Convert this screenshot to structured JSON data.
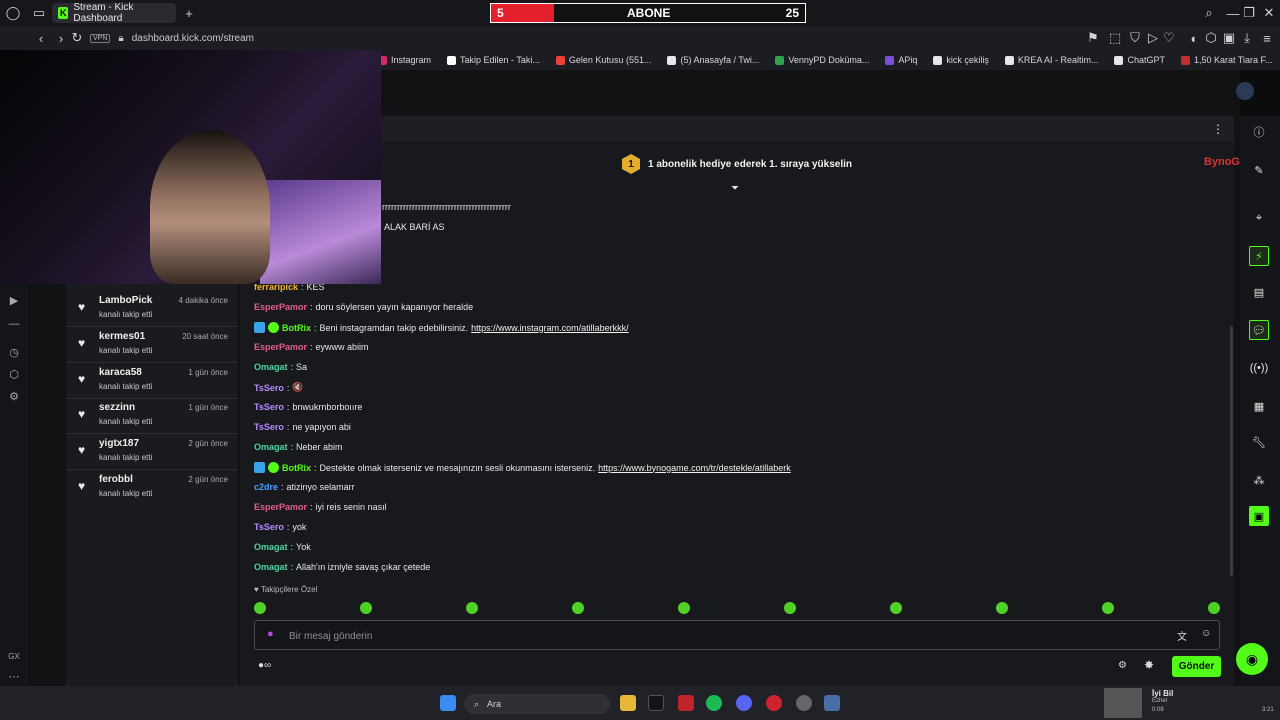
{
  "browser": {
    "tab_title": "Stream - Kick Dashboard",
    "url": "dashboard.kick.com/stream",
    "vpn_label": "VPN",
    "bookmarks": [
      {
        "label": "Instagram",
        "color": "#d6296b"
      },
      {
        "label": "Takip Edilen - Taki...",
        "color": "#ffffff"
      },
      {
        "label": "Gelen Kutusu (551...",
        "color": "#ea4335"
      },
      {
        "label": "(5) Anasayfa / Twi...",
        "color": "#e7e7e7"
      },
      {
        "label": "VennyPD Doküma...",
        "color": "#2ea44f"
      },
      {
        "label": "APiq",
        "color": "#7b4dd8"
      },
      {
        "label": "kick çekiliş",
        "color": "#e7e7e7"
      },
      {
        "label": "KREA AI - Realtim...",
        "color": "#e7e7e7"
      },
      {
        "label": "ChatGPT",
        "color": "#e7e7e7"
      },
      {
        "label": "1,50 Karat Tiara F...",
        "color": "#c03030"
      }
    ]
  },
  "overlay": {
    "left_count": "5",
    "label": "ABONE",
    "right_count": "25",
    "progress": 0.2
  },
  "follows": [
    {
      "name": "LamboPick",
      "action": "kanalı takip etti",
      "time": "4 dakika önce"
    },
    {
      "name": "kermes01",
      "action": "kanalı takip etti",
      "time": "20 saat önce"
    },
    {
      "name": "karaca58",
      "action": "kanalı takip etti",
      "time": "1 gün önce"
    },
    {
      "name": "sezzinn",
      "action": "kanalı takip etti",
      "time": "1 gün önce"
    },
    {
      "name": "yigtx187",
      "action": "kanalı takip etti",
      "time": "2 gün önce"
    },
    {
      "name": "ferobbl",
      "action": "kanalı takip etti",
      "time": "2 gün önce"
    }
  ],
  "chat": {
    "banner_badge": "1",
    "banner_text": "1 abonelik hediye ederek 1. sıraya yükselin",
    "sponsor_text": "BynoGame",
    "partial_lines": [
      "rrrrrrrrrrrrrrrrrrrrrrrrrrrrrrrrrrrrrrrrrrr",
      "ALAK BARİ AS"
    ],
    "messages": [
      {
        "user": "ferraripick",
        "color": "#f0b43a",
        "text": "KES",
        "bot": false
      },
      {
        "user": "EsperPamor",
        "color": "#e85b8f",
        "text": "doru söylersen yayın kapanıyor heralde",
        "bot": false
      },
      {
        "user": "BotRix",
        "color": "#53fc18",
        "text": "Beni instagramdan takip edebilirsiniz.",
        "link": "https://www.instagram.com/atillaberkkk/",
        "bot": true
      },
      {
        "user": "EsperPamor",
        "color": "#e85b8f",
        "text": "eywww abiim",
        "bot": false
      },
      {
        "user": "Omagat",
        "color": "#4cd6a6",
        "text": "Sa",
        "bot": false
      },
      {
        "user": "TsSero",
        "color": "#b68cff",
        "text": "🔇",
        "bot": false
      },
      {
        "user": "TsSero",
        "color": "#b68cff",
        "text": "bnwukrnborboııre",
        "bot": false
      },
      {
        "user": "TsSero",
        "color": "#b68cff",
        "text": "ne yapıyon abi",
        "bot": false
      },
      {
        "user": "Omagat",
        "color": "#4cd6a6",
        "text": "Neber abim",
        "bot": false
      },
      {
        "user": "BotRix",
        "color": "#53fc18",
        "text": "Destekte olmak isterseniz ve mesajınızın sesli okunmasını isterseniz.",
        "link": "https://www.bynogame.com/tr/destekle/atillaberk",
        "bot": true
      },
      {
        "user": "c2dre",
        "color": "#4a9eff",
        "text": "atizinyo selamarr",
        "bot": false
      },
      {
        "user": "EsperPamor",
        "color": "#e85b8f",
        "text": "iyi reis senin nasıl",
        "bot": false
      },
      {
        "user": "TsSero",
        "color": "#b68cff",
        "text": "yok",
        "bot": false
      },
      {
        "user": "Omagat",
        "color": "#4cd6a6",
        "text": "Yok",
        "bot": false
      },
      {
        "user": "Omagat",
        "color": "#4cd6a6",
        "text": "Allah'ın izniyle savaş çıkar çetede",
        "bot": false
      }
    ],
    "followers_only_label": "Takipçilere Özel",
    "input_placeholder": "Bir mesaj gönderin",
    "send_label": "Gönder"
  },
  "taskbar": {
    "search_label": "Ara",
    "now_playing_title": "İyi Bil",
    "now_playing_artist": "Ezhel",
    "now_playing_time": "0:08",
    "total_time": "3:21"
  },
  "sidebar_bottom_label": "GX"
}
